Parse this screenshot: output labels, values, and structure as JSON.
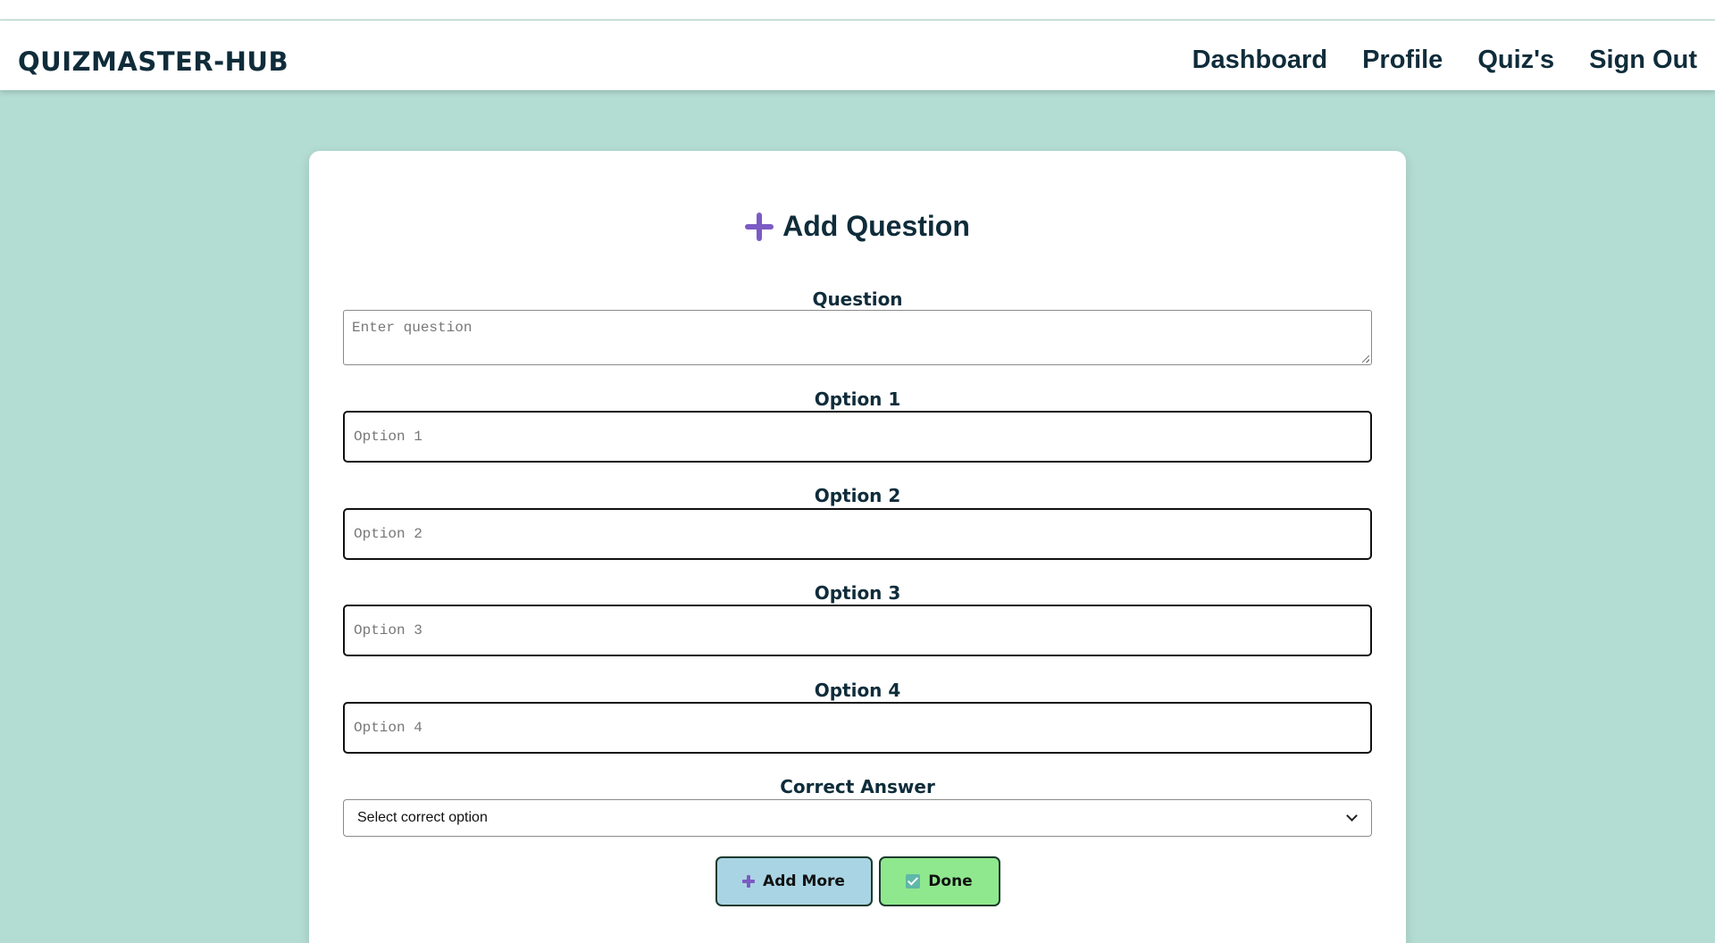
{
  "brand": "QUIZMASTER-HUB",
  "nav": {
    "links": [
      "Dashboard",
      "Profile",
      "Quiz's",
      "Sign Out"
    ]
  },
  "form": {
    "title": "Add Question",
    "question": {
      "label": "Question",
      "placeholder": "Enter question",
      "value": ""
    },
    "options": [
      {
        "label": "Option 1",
        "placeholder": "Option 1",
        "value": ""
      },
      {
        "label": "Option 2",
        "placeholder": "Option 2",
        "value": ""
      },
      {
        "label": "Option 3",
        "placeholder": "Option 3",
        "value": ""
      },
      {
        "label": "Option 4",
        "placeholder": "Option 4",
        "value": ""
      }
    ],
    "correct_answer": {
      "label": "Correct Answer",
      "selected": "Select correct option"
    },
    "buttons": {
      "add_more": "Add More",
      "done": "Done"
    }
  },
  "icons": {
    "title": "plus-icon",
    "add_more": "plus-icon",
    "done": "checkbox-check-icon"
  },
  "colors": {
    "background": "#b3dcd3",
    "text": "#0f2c3a",
    "accent": "#7b5bc4",
    "add_more_button": "#a9d4e3",
    "done_button": "#8fe88d"
  }
}
